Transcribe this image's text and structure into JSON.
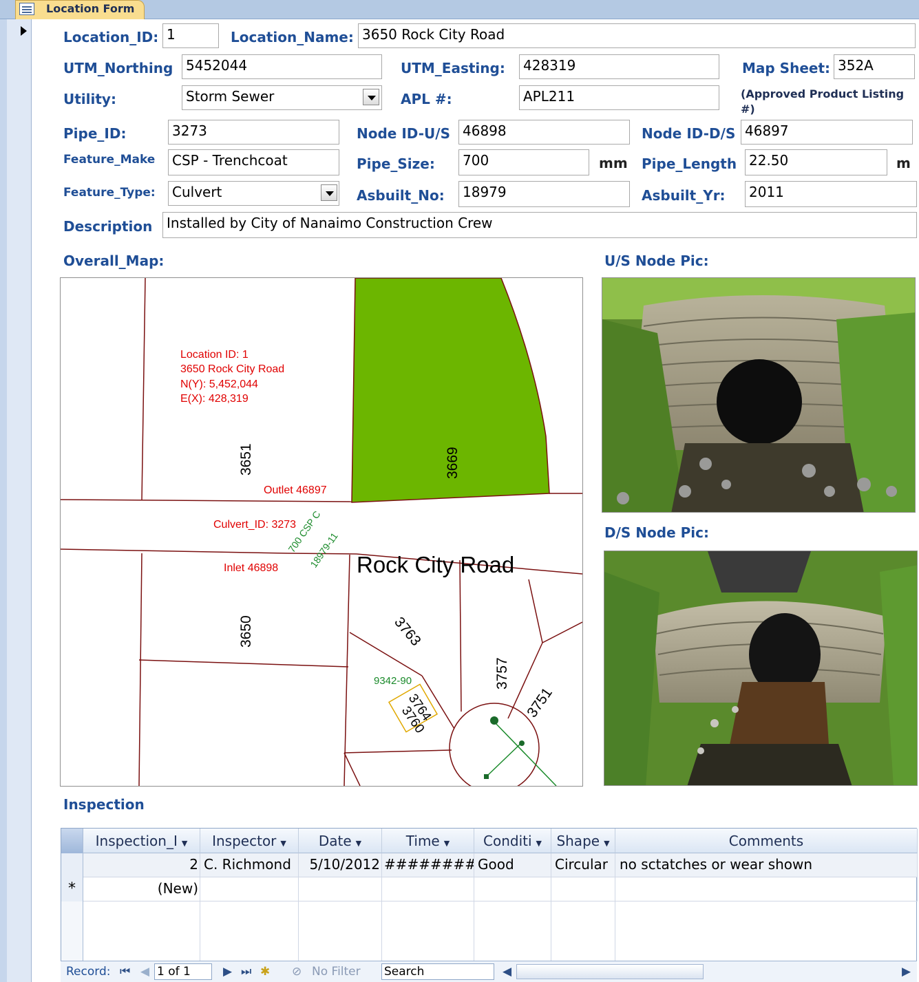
{
  "tab": {
    "title": "Location Form"
  },
  "form": {
    "location_id": {
      "label": "Location_ID:",
      "value": "1"
    },
    "location_name": {
      "label": "Location_Name:",
      "value": "3650 Rock City Road"
    },
    "utm_northing": {
      "label": "UTM_Northing",
      "value": "5452044"
    },
    "utm_easting": {
      "label": "UTM_Easting:",
      "value": "428319"
    },
    "map_sheet": {
      "label": "Map Sheet:",
      "value": "352A"
    },
    "utility": {
      "label": "Utility:",
      "value": "Storm Sewer"
    },
    "apl": {
      "label": "APL #:",
      "value": "APL211",
      "note": "(Approved Product Listing #)"
    },
    "pipe_id": {
      "label": "Pipe_ID:",
      "value": "3273"
    },
    "node_us": {
      "label": "Node ID-U/S",
      "value": "46898"
    },
    "node_ds": {
      "label": "Node ID-D/S",
      "value": "46897"
    },
    "feature_make": {
      "label": "Feature_Make",
      "value": "CSP - Trenchcoat"
    },
    "pipe_size": {
      "label": "Pipe_Size:",
      "value": "700",
      "unit": "mm"
    },
    "pipe_length": {
      "label": "Pipe_Length",
      "value": "22.50",
      "unit": "m"
    },
    "feature_type": {
      "label": "Feature_Type:",
      "value": "Culvert"
    },
    "asbuilt_no": {
      "label": "Asbuilt_No:",
      "value": "18979"
    },
    "asbuilt_yr": {
      "label": "Asbuilt_Yr:",
      "value": "2011"
    },
    "description": {
      "label": "Description",
      "value": "Installed by City of Nanaimo Construction Crew"
    }
  },
  "map": {
    "label": "Overall_Map:",
    "location_text": [
      "Location ID: 1",
      "3650 Rock City Road",
      "N(Y): 5,452,044",
      "E(X): 428,319"
    ],
    "outlet": "Outlet 46897",
    "culvert": "Culvert_ID: 3273",
    "inlet": "Inlet 46898",
    "road": "Rock City Road",
    "pipe_label_1": "700 CSP C",
    "pipe_label_2": "18979-11",
    "lot_ids": [
      "3651",
      "3669",
      "3650",
      "3763",
      "3757",
      "3751",
      "3764",
      "3760"
    ],
    "plan_id": "9342-90"
  },
  "photos": {
    "us_label": "U/S Node Pic:",
    "ds_label": "D/S Node Pic:"
  },
  "inspection": {
    "label": "Inspection",
    "columns": [
      "Inspection_I",
      "Inspector",
      "Date",
      "Time",
      "Conditi",
      "Shape",
      "Comments"
    ],
    "rows": [
      {
        "id": "2",
        "inspector": "C. Richmond",
        "date": "5/10/2012",
        "time": "###########",
        "condition": "Good",
        "shape": "Circular",
        "comments": "no sctatches or wear shown"
      }
    ],
    "new_row": {
      "marker": "*",
      "id": "(New)"
    }
  },
  "nav": {
    "record_label": "Record:",
    "current": "1 of 1",
    "filter": "No Filter",
    "search": "Search"
  }
}
